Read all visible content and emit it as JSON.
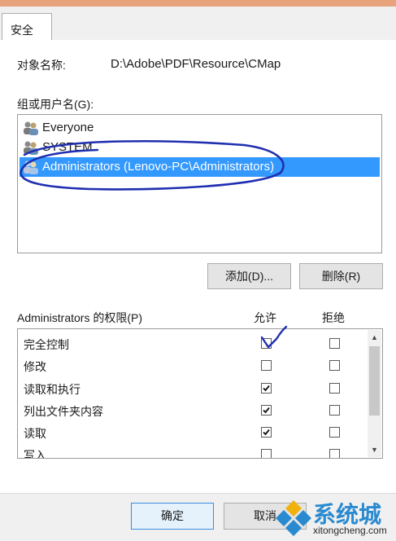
{
  "tab": {
    "label": "安全"
  },
  "object": {
    "label": "对象名称:",
    "value": "D:\\Adobe\\PDF\\Resource\\CMap"
  },
  "users": {
    "label": "组或用户名(G):",
    "items": [
      {
        "name": "Everyone",
        "icon": "users-icon",
        "selected": false
      },
      {
        "name": "SYSTEM",
        "icon": "users-icon",
        "selected": false
      },
      {
        "name": "Administrators (Lenovo-PC\\Administrators)",
        "icon": "users-icon",
        "selected": true
      }
    ]
  },
  "buttons": {
    "add": "添加(D)...",
    "remove": "删除(R)"
  },
  "permissions": {
    "label": "Administrators 的权限(P)",
    "allow_header": "允许",
    "deny_header": "拒绝",
    "rows": [
      {
        "name": "完全控制",
        "allow": false,
        "deny": false
      },
      {
        "name": "修改",
        "allow": false,
        "deny": false
      },
      {
        "name": "读取和执行",
        "allow": true,
        "deny": false
      },
      {
        "name": "列出文件夹内容",
        "allow": true,
        "deny": false
      },
      {
        "name": "读取",
        "allow": true,
        "deny": false
      },
      {
        "name": "写入",
        "allow": false,
        "deny": false
      }
    ]
  },
  "footer": {
    "ok": "确定",
    "cancel": "取消"
  },
  "watermark": {
    "text": "系统城",
    "url": "xitongcheng.com"
  },
  "colors": {
    "selection": "#3399ff",
    "ink": "#1f2fb0",
    "titlebar": "#e8a37c"
  }
}
